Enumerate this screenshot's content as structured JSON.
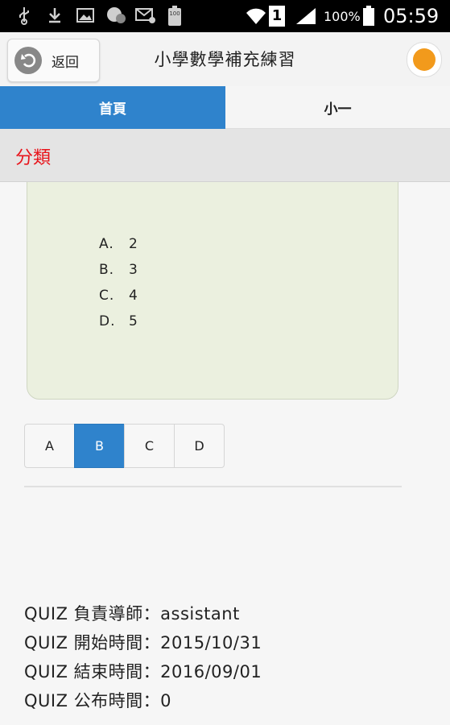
{
  "status_bar": {
    "battery_percent": "100%",
    "time": "05:59",
    "sim_slot": "1",
    "notification_badge": "100"
  },
  "header": {
    "back_label": "返回",
    "title": "小學數學補充練習"
  },
  "tabs": [
    {
      "label": "首頁",
      "active": true
    },
    {
      "label": "小一",
      "active": false
    }
  ],
  "category": {
    "label": "分類"
  },
  "question": {
    "options": [
      {
        "letter": "A.",
        "value": "2"
      },
      {
        "letter": "B.",
        "value": "3"
      },
      {
        "letter": "C.",
        "value": "4"
      },
      {
        "letter": "D.",
        "value": "5"
      }
    ]
  },
  "answer_choices": [
    {
      "label": "A",
      "selected": false
    },
    {
      "label": "B",
      "selected": true
    },
    {
      "label": "C",
      "selected": false
    },
    {
      "label": "D",
      "selected": false
    }
  ],
  "quiz_info": [
    "QUIZ 負責導師：assistant",
    "QUIZ 開始時間：2015/10/31",
    "QUIZ 結束時間：2016/09/01",
    "QUIZ 公布時間：0"
  ],
  "colors": {
    "accent": "#2f83cc",
    "category_text": "#e8141b",
    "question_bg": "#ebf0df"
  },
  "icons": [
    "usb-icon",
    "download-icon",
    "image-icon",
    "chat-icon",
    "mail-icon",
    "battery-notify-icon",
    "wifi-icon",
    "signal-icon",
    "battery-icon",
    "back-arrow-icon",
    "avatar-icon"
  ]
}
